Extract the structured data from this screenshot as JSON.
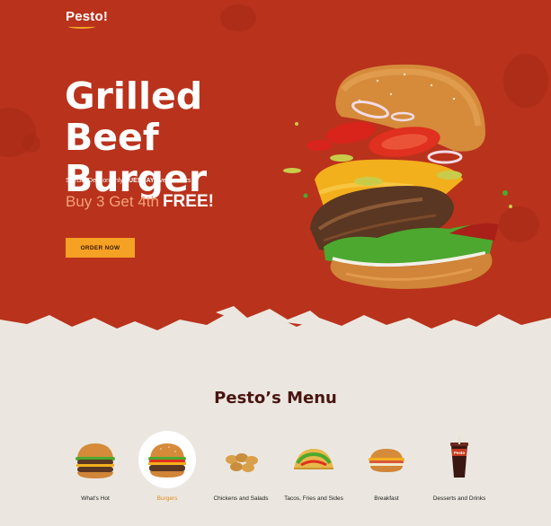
{
  "brand": {
    "logo": "Pesto!"
  },
  "hero": {
    "title": "Grilled Beef Burger",
    "deal_prefix": "Special Deal on only ",
    "deal_day": "TUESDAY",
    "deal_suffix": " every weeks",
    "promo": "Buy 3 Get 4th",
    "promo_free": "FREE!",
    "cta_label": "ORDER NOW"
  },
  "menu": {
    "title": "Pesto’s Menu",
    "categories": [
      {
        "label": "What's Hot",
        "icon": "double-burger-icon",
        "active": false
      },
      {
        "label": "Burgers",
        "icon": "burger-icon",
        "active": true
      },
      {
        "label": "Chickens and Salads",
        "icon": "chicken-nuggets-icon",
        "active": false
      },
      {
        "label": "Tacos, Fries and Sides",
        "icon": "tacos-icon",
        "active": false
      },
      {
        "label": "Breakfast",
        "icon": "breakfast-sandwich-icon",
        "active": false
      },
      {
        "label": "Desserts and Drinks",
        "icon": "soda-cup-icon",
        "active": false
      }
    ]
  },
  "colors": {
    "hero_background": "#b9321c",
    "page_background": "#ebe7e0",
    "accent": "#f5a123",
    "menu_title": "#4a1410",
    "active_category": "#e58a1c"
  }
}
